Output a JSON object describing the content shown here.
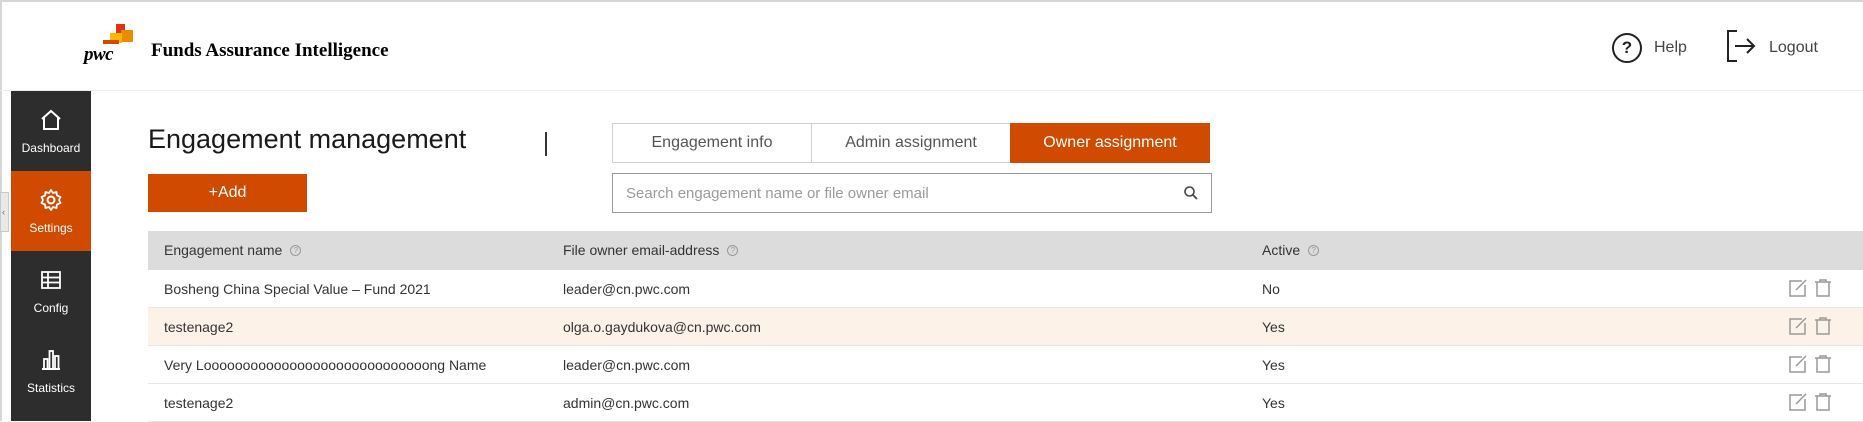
{
  "app": {
    "logo_text": "pwc",
    "title": "Funds Assurance Intelligence",
    "help_label": "Help",
    "logout_label": "Logout"
  },
  "sidebar": {
    "items": [
      {
        "label": "Dashboard",
        "icon": "home-icon",
        "active": false
      },
      {
        "label": "Settings",
        "icon": "gear-icon",
        "active": true
      },
      {
        "label": "Config",
        "icon": "table-icon",
        "active": false
      },
      {
        "label": "Statistics",
        "icon": "bar-chart-icon",
        "active": false
      }
    ]
  },
  "main": {
    "title": "Engagement management",
    "add_label": "+Add",
    "tabs": [
      {
        "label": "Engagement info",
        "active": false
      },
      {
        "label": "Admin assignment",
        "active": false
      },
      {
        "label": "Owner assignment",
        "active": true
      }
    ],
    "search": {
      "placeholder": "Search engagement name or file owner email",
      "value": ""
    }
  },
  "table": {
    "columns": [
      "Engagement name",
      "File owner email-address",
      "Active"
    ],
    "rows": [
      {
        "name": "Bosheng China Special Value – Fund 2021",
        "email": "leader@cn.pwc.com",
        "active": "No"
      },
      {
        "name": "testenage2",
        "email": "olga.o.gaydukova@cn.pwc.com",
        "active": "Yes"
      },
      {
        "name": "Very Looooooooooooooooooooooooooooong Name",
        "email": "leader@cn.pwc.com",
        "active": "Yes"
      },
      {
        "name": "testenage2",
        "email": "admin@cn.pwc.com",
        "active": "Yes"
      }
    ]
  },
  "colors": {
    "accent": "#d04a02",
    "sidebar_bg": "#2d2d2d",
    "header_row_bg": "#dcdcdc",
    "highlight_row_bg": "#fdf2e8"
  }
}
